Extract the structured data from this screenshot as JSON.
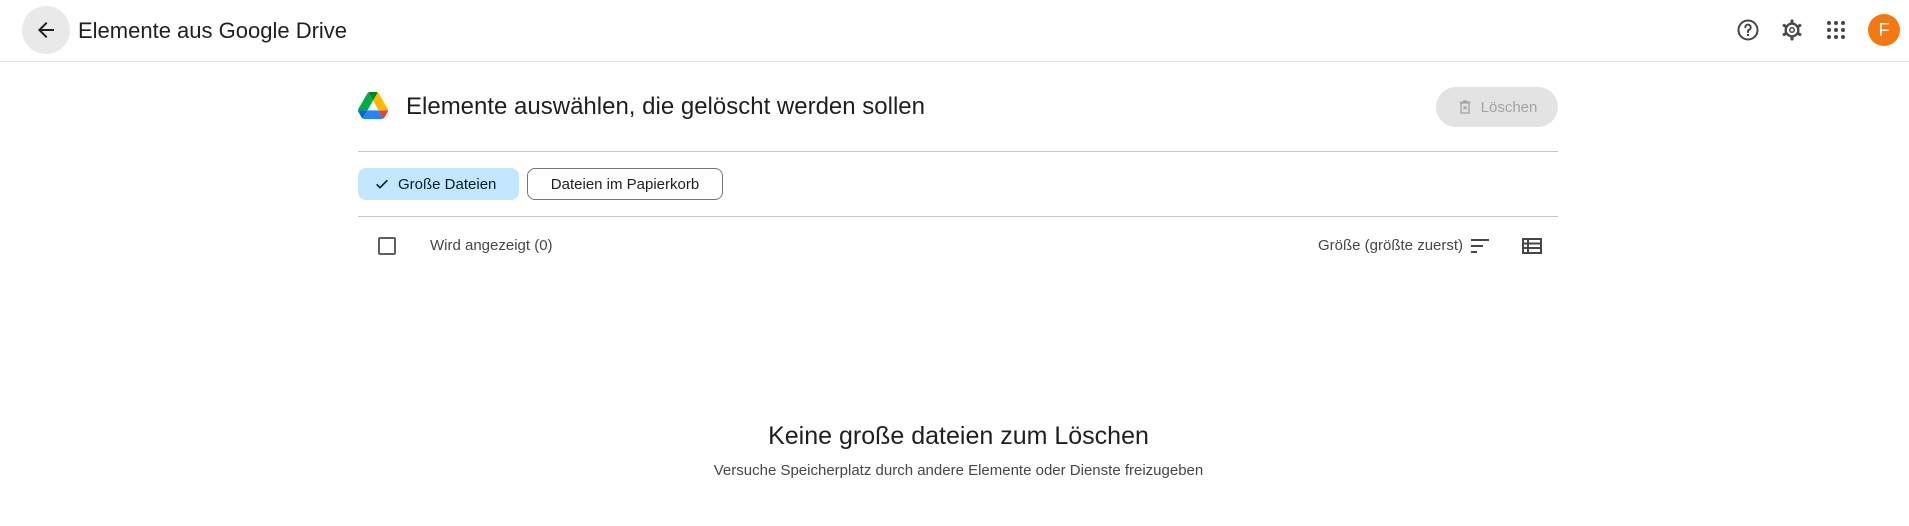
{
  "topbar": {
    "title": "Elemente aus Google Drive",
    "icons": [
      "arrow-back-icon",
      "help-icon",
      "settings-icon",
      "apps-grid-icon"
    ],
    "avatar_letter": "F",
    "avatar_color": "#f4780f"
  },
  "header": {
    "title": "Elemente auswählen, die gelöscht werden sollen",
    "delete_label": "Löschen"
  },
  "filters": {
    "large_files": "Große Dateien",
    "trash_files": "Dateien im Papierkorb"
  },
  "list": {
    "shown_label": "Wird angezeigt (0)",
    "sort_label": "Größe (größte zuerst)"
  },
  "empty": {
    "title": "Keine große dateien zum Löschen",
    "subtitle": "Versuche Speicherplatz durch andere Elemente oder Dienste freizugeben"
  },
  "colors": {
    "selected_chip": "#c2e7ff",
    "avatar": "#f4780f"
  }
}
